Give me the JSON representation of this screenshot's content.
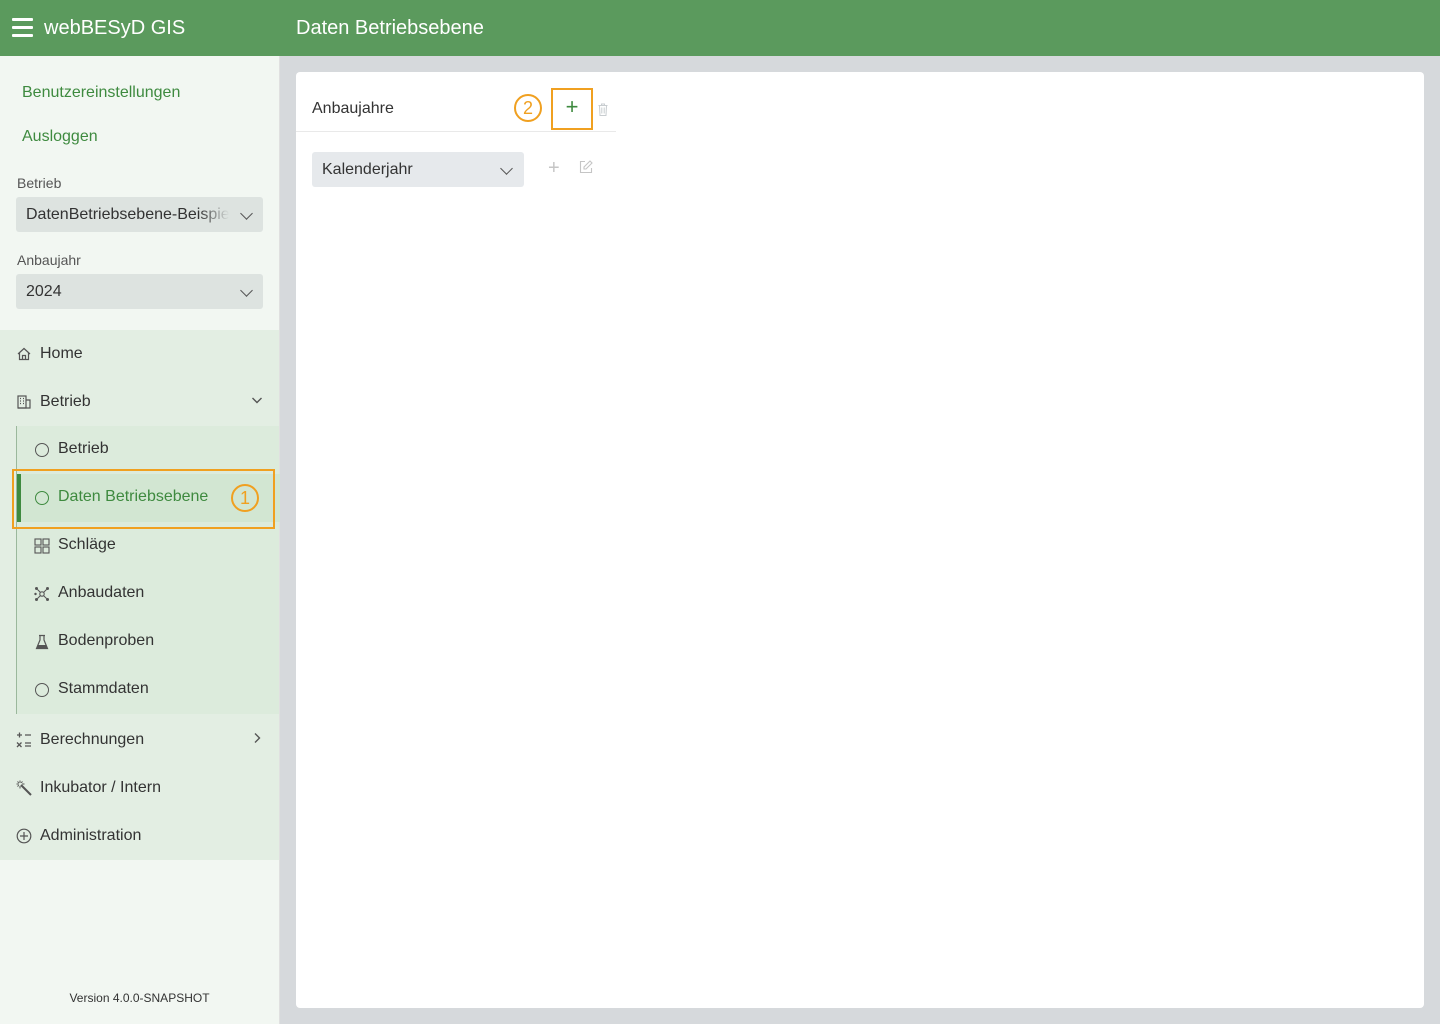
{
  "header": {
    "app_title": "webBESyD GIS",
    "page_title": "Daten Betriebsebene"
  },
  "sidebar": {
    "links": {
      "settings": "Benutzereinstellungen",
      "logout": "Ausloggen"
    },
    "betrieb": {
      "label": "Betrieb",
      "value": "DatenBetriebsebene-Beispiel"
    },
    "anbaujahr": {
      "label": "Anbaujahr",
      "value": "2024"
    },
    "nav": {
      "home": "Home",
      "betrieb": "Betrieb",
      "sub": {
        "betrieb": "Betrieb",
        "daten_betriebsebene": "Daten Betriebsebene",
        "schlaege": "Schläge",
        "anbaudaten": "Anbaudaten",
        "bodenproben": "Bodenproben",
        "stammdaten": "Stammdaten"
      },
      "berechnungen": "Berechnungen",
      "inkubator": "Inkubator / Intern",
      "administration": "Administration"
    },
    "version": "Version 4.0.0-SNAPSHOT"
  },
  "main": {
    "section_title": "Anbaujahre",
    "add_label": "+",
    "calendar_select": "Kalenderjahr",
    "calendar_add_label": "+"
  },
  "annotations": {
    "step1": "1",
    "step2": "2"
  },
  "colors": {
    "header_green": "#5b9a5d",
    "accent_green": "#3e8a3f",
    "highlight_orange": "#f0a020"
  }
}
